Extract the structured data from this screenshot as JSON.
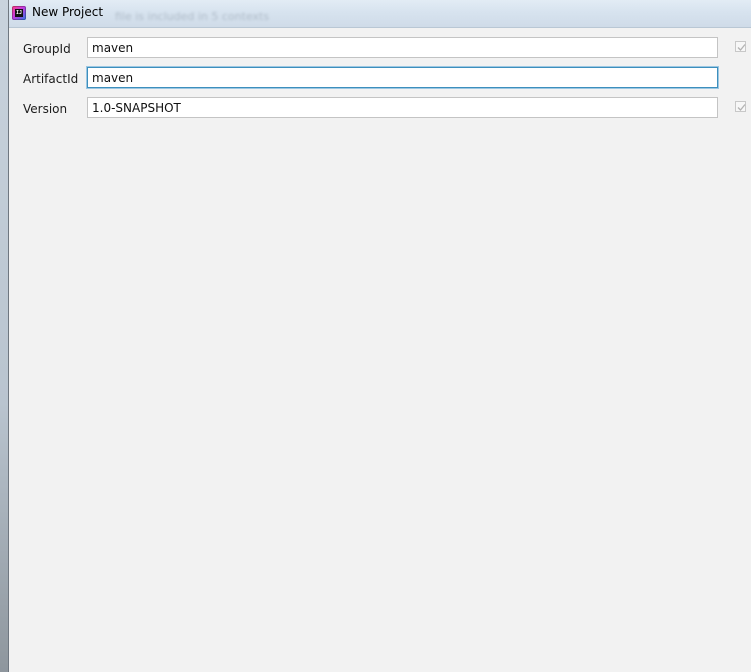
{
  "window": {
    "title": "New Project",
    "background_hint": "file is included in 5 contexts"
  },
  "form": {
    "fields": [
      {
        "label": "GroupId",
        "value": "maven",
        "inherit_checked": true,
        "focused": false
      },
      {
        "label": "ArtifactId",
        "value": "maven",
        "inherit_checked": false,
        "focused": true
      },
      {
        "label": "Version",
        "value": "1.0-SNAPSHOT",
        "inherit_checked": true,
        "focused": false
      }
    ]
  },
  "colors": {
    "focus_border": "#3d8fbd",
    "dialog_background": "#f2f2f2"
  },
  "icons": {
    "app": "intellij-app-icon",
    "inherit": "check-icon"
  }
}
